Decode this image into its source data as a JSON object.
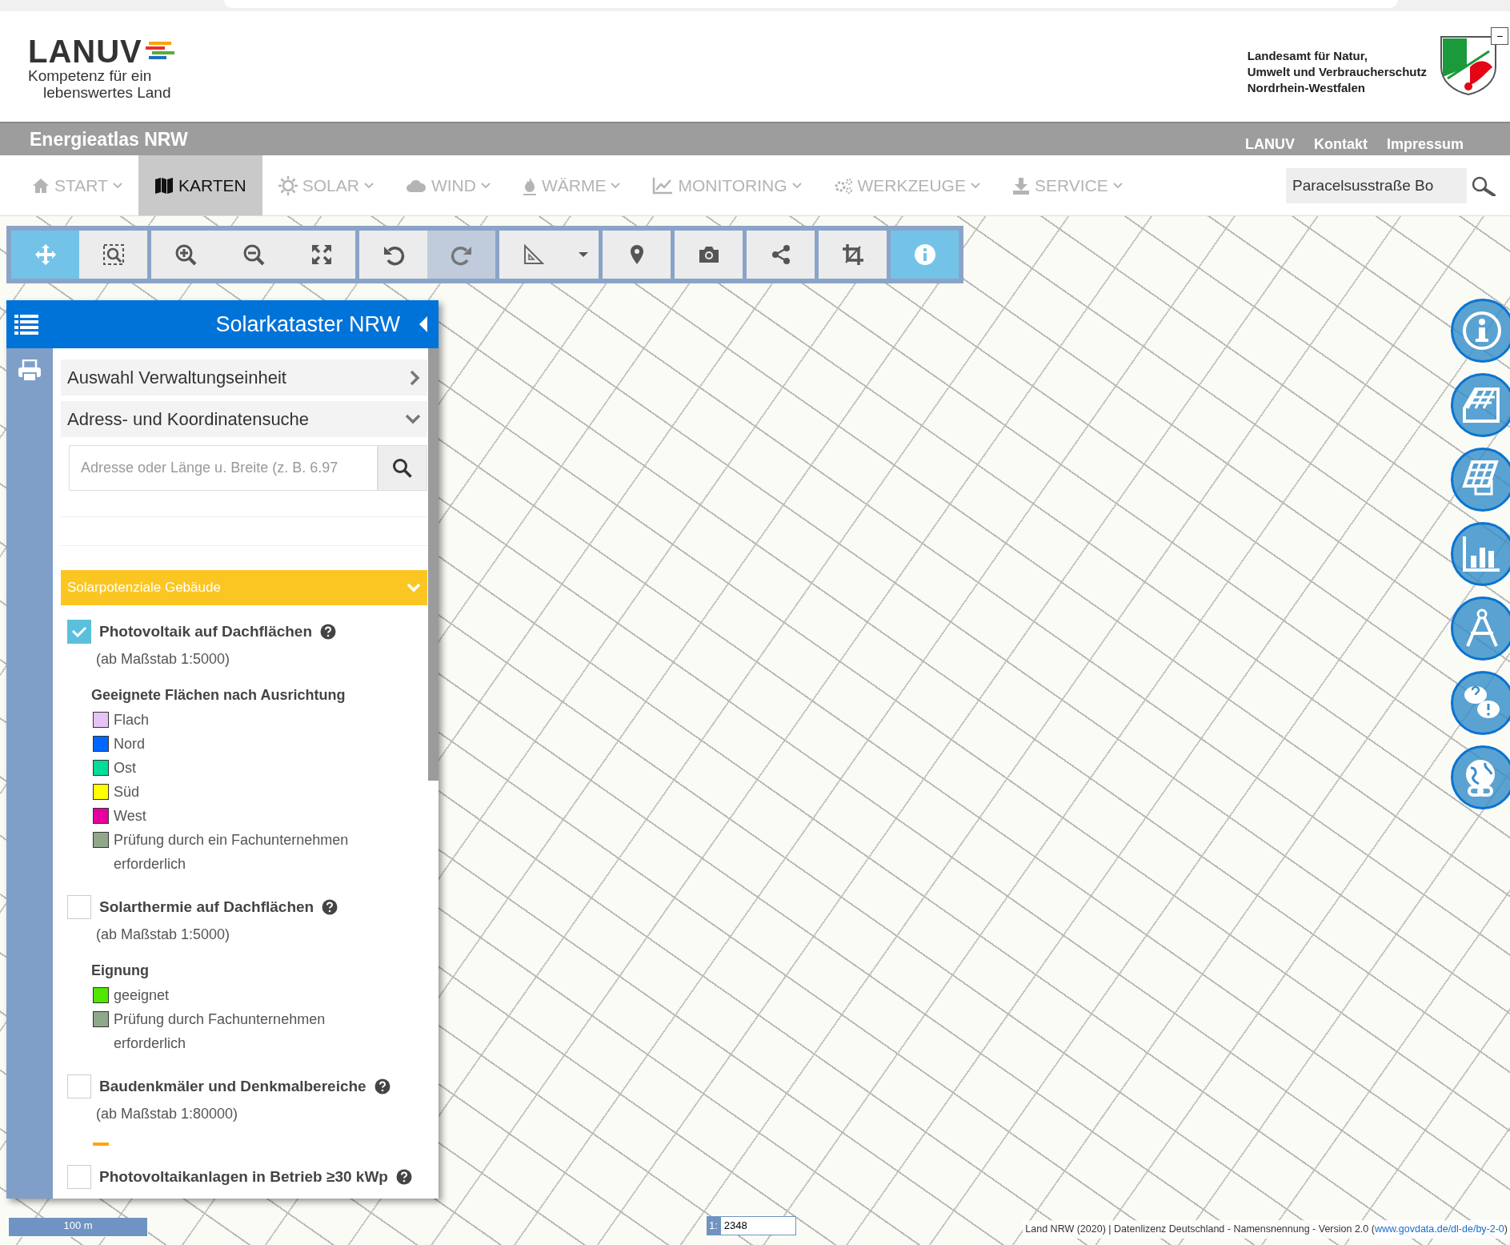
{
  "browser_bar": {
    "minimize": "−"
  },
  "header": {
    "logo": {
      "name": "LANUV",
      "tagline_1": "Kompetenz für ein",
      "tagline_2": "lebenswertes Land"
    },
    "agency": [
      "Landesamt für Natur,",
      "Umwelt und Verbraucherschutz",
      "Nordrhein-Westfalen"
    ]
  },
  "title_bar": {
    "title": "Energieatlas NRW",
    "links": [
      "LANUV",
      "Kontakt",
      "Impressum"
    ]
  },
  "nav": {
    "items": [
      {
        "label": "START",
        "selected": false,
        "dropdown": true
      },
      {
        "label": "KARTEN",
        "selected": true,
        "dropdown": false
      },
      {
        "label": "SOLAR",
        "selected": false,
        "dropdown": true
      },
      {
        "label": "WIND",
        "selected": false,
        "dropdown": true
      },
      {
        "label": "WÄRME",
        "selected": false,
        "dropdown": true
      },
      {
        "label": "MONITORING",
        "selected": false,
        "dropdown": true
      },
      {
        "label": "WERKZEUGE",
        "selected": false,
        "dropdown": true
      },
      {
        "label": "SERVICE",
        "selected": false,
        "dropdown": true
      }
    ],
    "search": {
      "value": "Paracelsusstraße Bo"
    }
  },
  "toolbar": {
    "tools": [
      {
        "active": true,
        "disabled": false
      },
      {
        "active": false,
        "disabled": false
      },
      {
        "active": false,
        "disabled": false
      },
      {
        "active": false,
        "disabled": false
      },
      {
        "active": false,
        "disabled": false
      },
      {
        "active": false,
        "disabled": false
      },
      {
        "active": false,
        "disabled": true
      },
      {
        "active": false,
        "disabled": false
      },
      {
        "active": false,
        "disabled": false
      },
      {
        "active": false,
        "disabled": false
      },
      {
        "active": false,
        "disabled": false
      },
      {
        "active": false,
        "disabled": false
      },
      {
        "active": false,
        "disabled": false
      },
      {
        "active": true,
        "disabled": false
      }
    ]
  },
  "panel": {
    "title": "Solarkataster NRW",
    "sections": [
      {
        "label": "Auswahl Verwaltungseinheit",
        "expanded": false
      },
      {
        "label": "Adress- und Koordinatensuche",
        "expanded": true
      }
    ],
    "search": {
      "placeholder": "Adresse oder Länge u. Breite (z. B. 6.97"
    },
    "layer_group": {
      "title": "Solarpotenziale Gebäude",
      "expanded": true
    },
    "layers": [
      {
        "label": "Photovoltaik auf Dachflächen",
        "scale": "(ab Maßstab 1:5000)",
        "checked": true,
        "legend_title": "Geeignete Flächen nach Ausrichtung",
        "legend": [
          {
            "kind": "swatch",
            "label": "Flach",
            "color": "#e6c3f5"
          },
          {
            "kind": "swatch",
            "label": "Nord",
            "color": "#0066ff"
          },
          {
            "kind": "swatch",
            "label": "Ost",
            "color": "#00dc9b"
          },
          {
            "kind": "swatch",
            "label": "Süd",
            "color": "#ffff00"
          },
          {
            "kind": "swatch",
            "label": "West",
            "color": "#e600a0"
          },
          {
            "kind": "swatch",
            "label": "Prüfung durch ein Fachunternehmen erforderlich",
            "color": "#8fa88a"
          }
        ]
      },
      {
        "label": "Solarthermie auf Dachflächen",
        "scale": "(ab Maßstab 1:5000)",
        "checked": false,
        "legend_title": "Eignung",
        "legend": [
          {
            "kind": "swatch",
            "label": "geeignet",
            "color": "#50e600"
          },
          {
            "kind": "swatch",
            "label": "Prüfung durch Fachunternehmen erforderlich",
            "color": "#8fa88a"
          }
        ]
      },
      {
        "label": "Baudenkmäler und Denkmalbereiche",
        "scale": "(ab Maßstab 1:80000)",
        "checked": false,
        "legend": [
          {
            "kind": "line",
            "color": "#ffa500"
          }
        ]
      },
      {
        "label": "Photovoltaikanlagen in Betrieb ≥30 kWp",
        "checked": false
      }
    ]
  },
  "map": {
    "scale_bar": "100 m",
    "scale": {
      "prefix": "1:",
      "value": "2348"
    },
    "attribution": {
      "text": "Land NRW (2020) | Datenlizenz Deutschland - Namensnennung - Version 2.0 (",
      "link": "www.govdata.de/dl-de/by-2-0",
      "suffix": ")"
    }
  }
}
